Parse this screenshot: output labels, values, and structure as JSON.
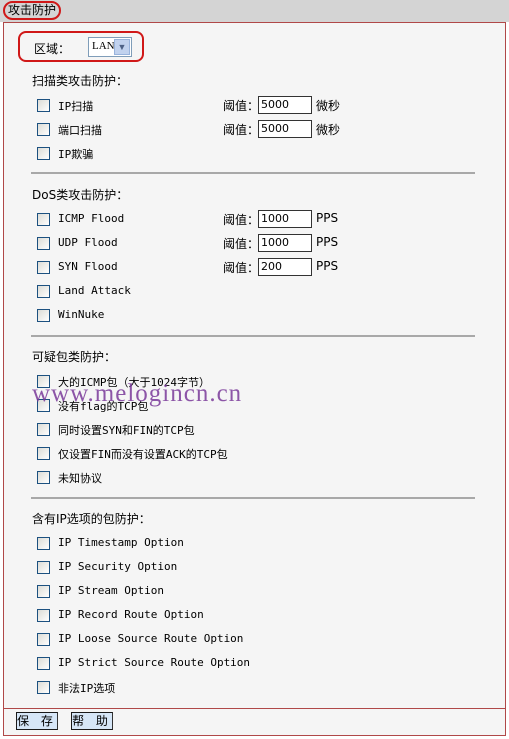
{
  "title": "攻击防护",
  "zone": {
    "label": "区域：",
    "value": "LAN"
  },
  "threshold_label": "阈值：",
  "sections": [
    {
      "title": "扫描类攻击防护：",
      "items": [
        {
          "label": "IP扫描",
          "threshold": "5000",
          "unit": "微秒",
          "checked": false
        },
        {
          "label": "端口扫描",
          "threshold": "5000",
          "unit": "微秒",
          "checked": false
        },
        {
          "label": "IP欺骗",
          "checked": false
        }
      ]
    },
    {
      "title": "DoS类攻击防护：",
      "items": [
        {
          "label": "ICMP Flood",
          "threshold": "1000",
          "unit": "PPS",
          "checked": false
        },
        {
          "label": "UDP Flood",
          "threshold": "1000",
          "unit": "PPS",
          "checked": false
        },
        {
          "label": "SYN Flood",
          "threshold": "200",
          "unit": "PPS",
          "checked": false
        },
        {
          "label": "Land Attack",
          "checked": false
        },
        {
          "label": "WinNuke",
          "checked": false
        }
      ]
    },
    {
      "title": "可疑包类防护：",
      "items": [
        {
          "label": "大的ICMP包（大于1024字节）",
          "checked": false
        },
        {
          "label": "没有flag的TCP包",
          "checked": false
        },
        {
          "label": "同时设置SYN和FIN的TCP包",
          "checked": false
        },
        {
          "label": "仅设置FIN而没有设置ACK的TCP包",
          "checked": false
        },
        {
          "label": "未知协议",
          "checked": false
        }
      ]
    },
    {
      "title": "含有IP选项的包防护：",
      "items": [
        {
          "label": "IP Timestamp Option",
          "checked": false
        },
        {
          "label": "IP Security Option",
          "checked": false
        },
        {
          "label": "IP Stream Option",
          "checked": false
        },
        {
          "label": "IP Record Route Option",
          "checked": false
        },
        {
          "label": "IP Loose Source Route Option",
          "checked": false
        },
        {
          "label": "IP Strict Source Route Option",
          "checked": false
        },
        {
          "label": "非法IP选项",
          "checked": false
        }
      ]
    }
  ],
  "buttons": {
    "save": "保 存",
    "help": "帮 助"
  },
  "watermark": "www.melogincn.cn",
  "colors": {
    "border": "#b04848",
    "highlight": "#d01818",
    "button": "#d6e6f7"
  }
}
